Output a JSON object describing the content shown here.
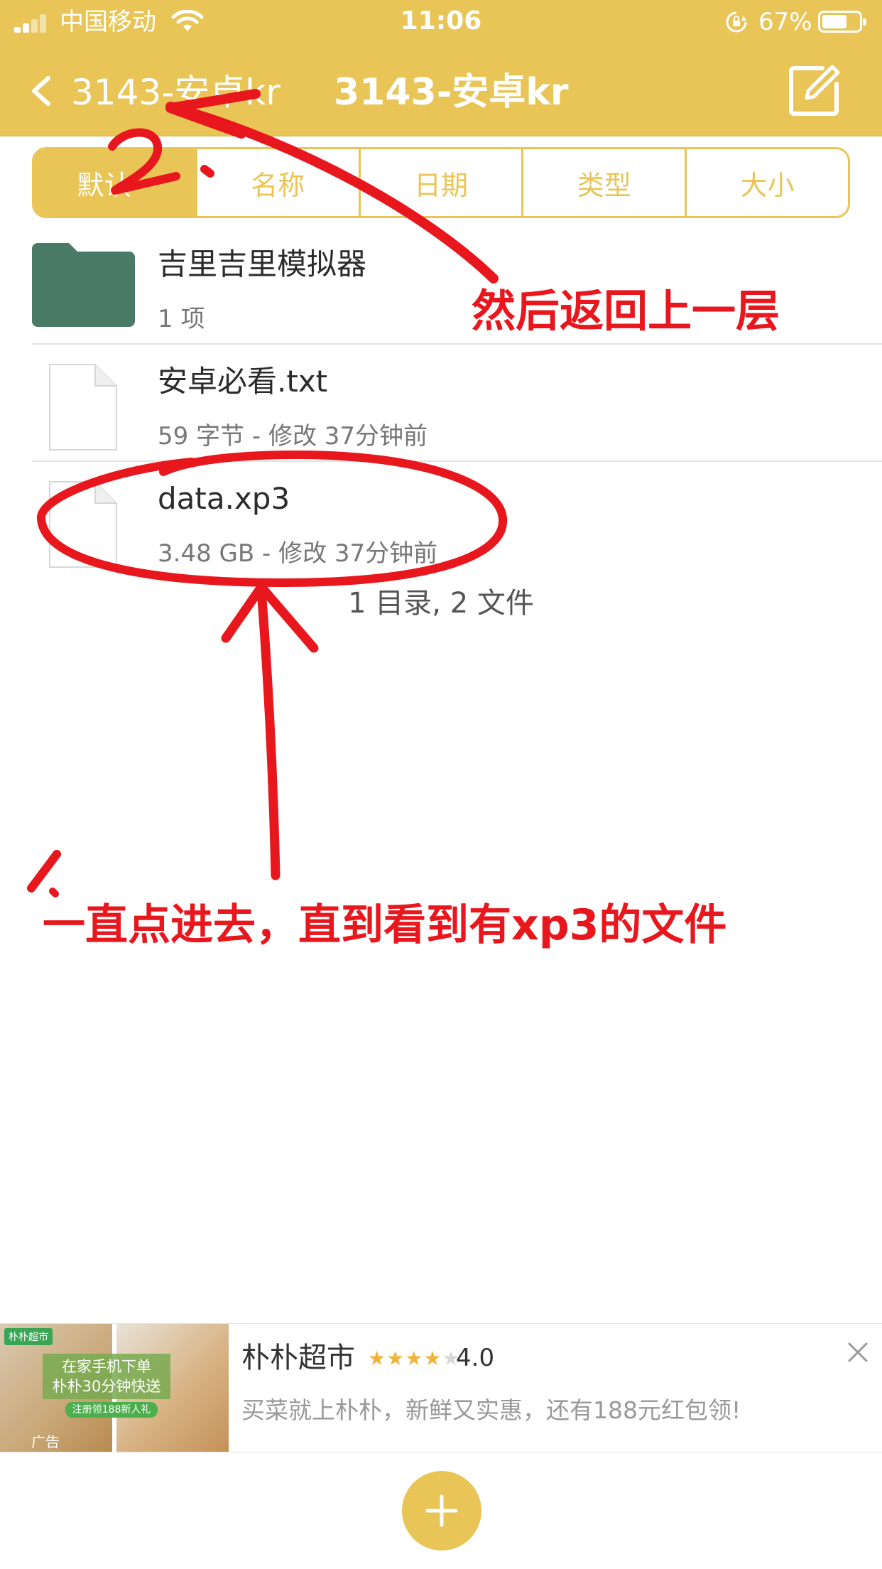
{
  "status_bar": {
    "carrier": "中国移动",
    "time": "11:06",
    "battery_percent": "67%",
    "battery_level": 0.67
  },
  "nav": {
    "back_label": "3143-安卓kr",
    "title": "3143-安卓kr"
  },
  "sort_tabs": [
    {
      "label": "默认",
      "active": true
    },
    {
      "label": "名称",
      "active": false
    },
    {
      "label": "日期",
      "active": false
    },
    {
      "label": "类型",
      "active": false
    },
    {
      "label": "大小",
      "active": false
    }
  ],
  "files": [
    {
      "name": "吉里吉里模拟器",
      "meta": "1 项",
      "icon": "folder-icon"
    },
    {
      "name": "安卓必看.txt",
      "meta": "59 字节 - 修改 37分钟前",
      "icon": "document-icon"
    },
    {
      "name": "data.xp3",
      "meta": "3.48 GB - 修改 37分钟前",
      "icon": "document-icon"
    }
  ],
  "summary": "1 目录, 2 文件",
  "annotations": {
    "top_note": "然后返回上一层",
    "bottom_note": "一直点进去，直到看到有xp3的文件",
    "step_number": "2"
  },
  "ad": {
    "brand_badge": "朴朴超市",
    "image_slogan_line1": "在家手机下单",
    "image_slogan_line2": "朴朴30分钟快送",
    "image_cta": "注册领188新人礼",
    "tag": "广告",
    "title": "朴朴超市",
    "rating": "4.0",
    "rating_value": 4.0,
    "description": "买菜就上朴朴，新鲜又实惠，还有188元红包领!"
  },
  "colors": {
    "accent": "#e9c557",
    "folder": "#4a7b68",
    "annotation": "#e8171d"
  }
}
